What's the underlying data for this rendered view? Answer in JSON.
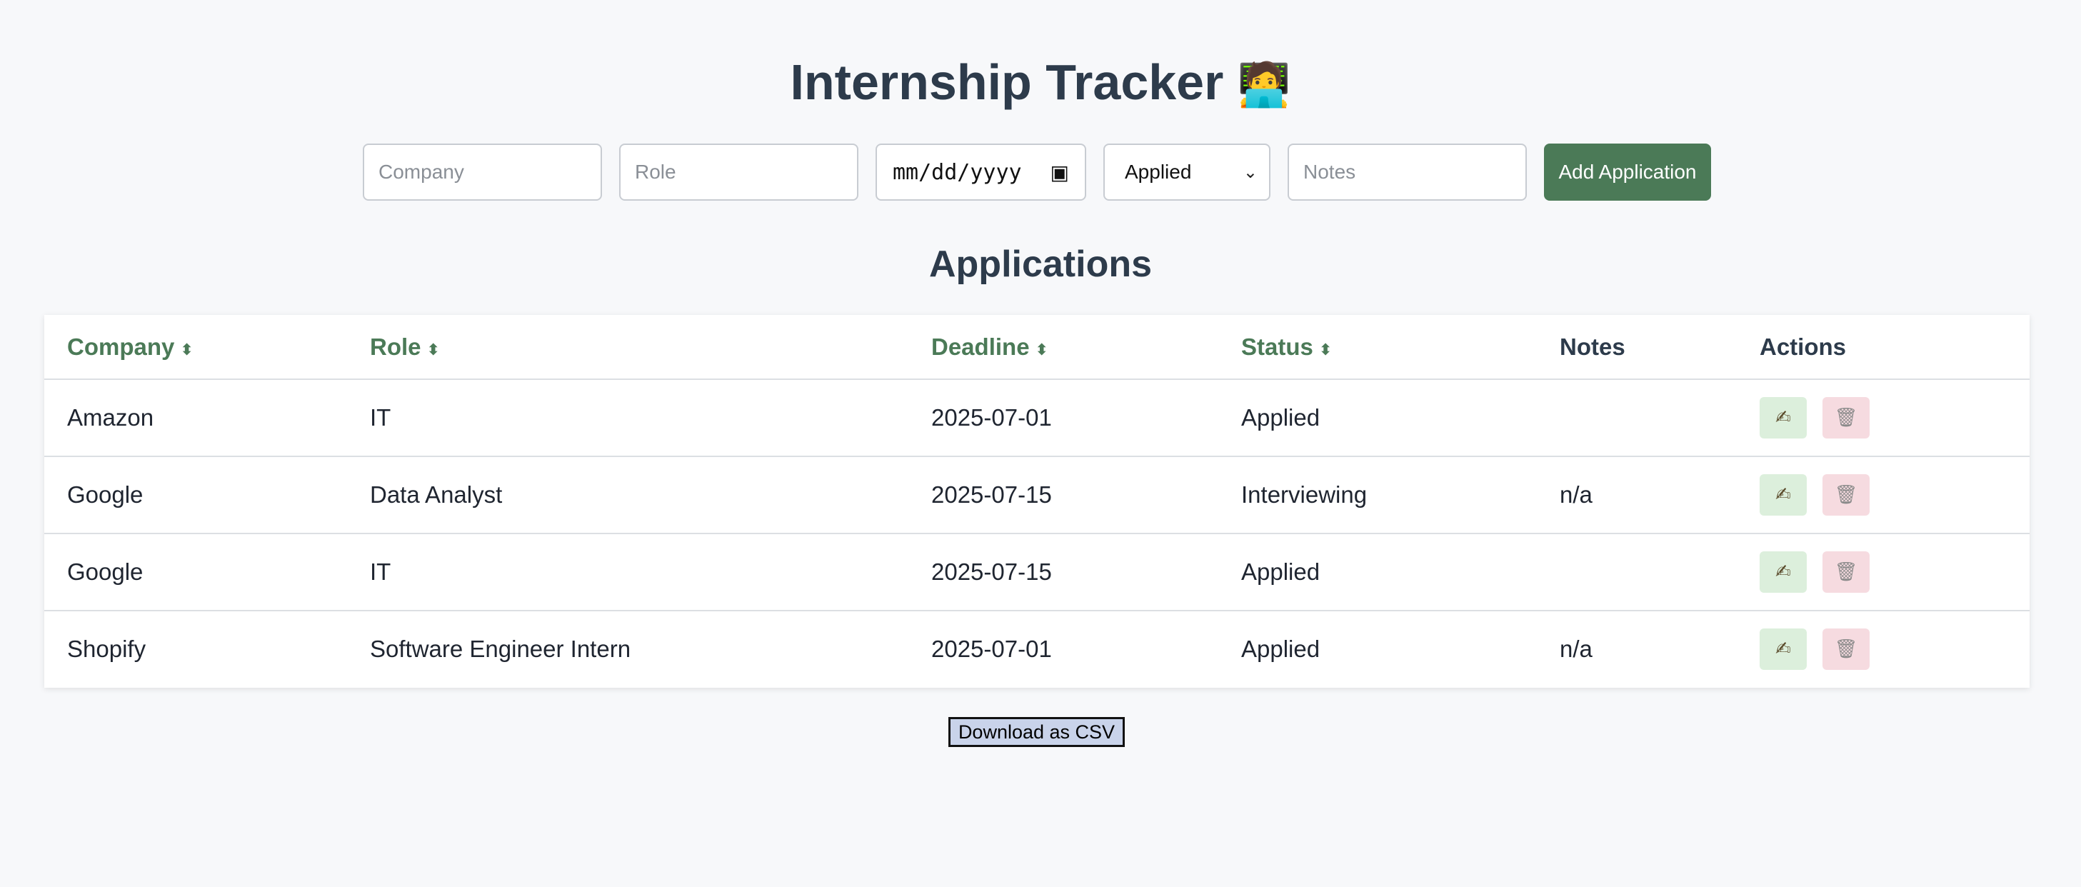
{
  "header": {
    "title": "Internship Tracker",
    "title_emoji": "🧑‍💻"
  },
  "form": {
    "company_placeholder": "Company",
    "role_placeholder": "Role",
    "date_placeholder": "mm/dd/yyyy",
    "status_value": "Applied",
    "notes_placeholder": "Notes",
    "add_label": "Add Application"
  },
  "section": {
    "title": "Applications"
  },
  "table": {
    "columns": [
      "Company",
      "Role",
      "Deadline",
      "Status",
      "Notes",
      "Actions"
    ],
    "sort_indicator": "⬍",
    "rows": [
      {
        "company": "Amazon",
        "role": "IT",
        "deadline": "2025-07-01",
        "status": "Applied",
        "notes": ""
      },
      {
        "company": "Google",
        "role": "Data Analyst",
        "deadline": "2025-07-15",
        "status": "Interviewing",
        "notes": "n/a"
      },
      {
        "company": "Google",
        "role": "IT",
        "deadline": "2025-07-15",
        "status": "Applied",
        "notes": ""
      },
      {
        "company": "Shopify",
        "role": "Software Engineer Intern",
        "deadline": "2025-07-01",
        "status": "Applied",
        "notes": "n/a"
      }
    ],
    "edit_icon": "✍",
    "delete_icon": "🗑"
  },
  "footer": {
    "download_label": "Download as CSV"
  },
  "colors": {
    "accent": "#4b7a57",
    "text": "#2d3b4b",
    "background": "#f7f8fa"
  }
}
